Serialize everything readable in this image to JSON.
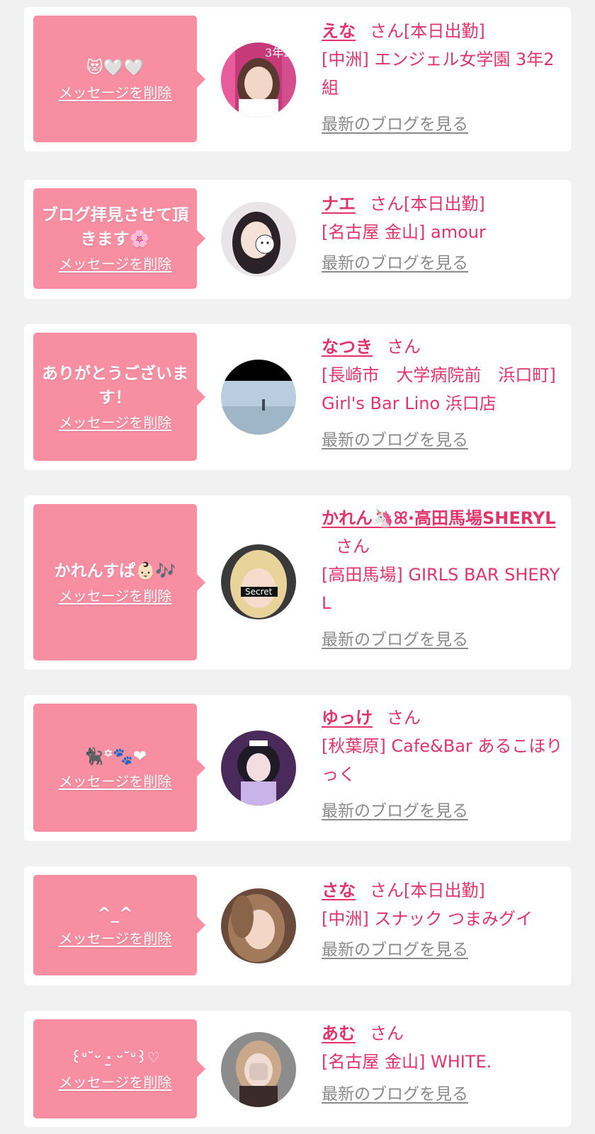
{
  "items": [
    {
      "message": "😻🤍🤍",
      "delete_label": "メッセージを削除",
      "name": "えな",
      "san": "さん",
      "status": "[本日出勤]",
      "shop": "[中洲] エンジェル女学園 3年2組",
      "blog_label": "最新のブログを見る"
    },
    {
      "message": "ブログ拝見させて頂きます🌸",
      "delete_label": "メッセージを削除",
      "name": "ナエ",
      "san": "さん",
      "status": "[本日出勤]",
      "shop": "[名古屋 金山] amour",
      "blog_label": "最新のブログを見る"
    },
    {
      "message": "ありがとうございます！",
      "delete_label": "メッセージを削除",
      "name": "なつき",
      "san": "さん",
      "status": "",
      "shop": "[長崎市　大学病院前　浜口町] Girl's Bar Lino 浜口店",
      "blog_label": "最新のブログを見る"
    },
    {
      "message": "かれんすぱ👶🏻🎶",
      "delete_label": "メッセージを削除",
      "name": "かれん🦄ꕤ·高田馬場SHERYL",
      "san": "さん",
      "status": "",
      "shop": "[高田馬場] GIRLS BAR SHERYL",
      "blog_label": "最新のブログを見る"
    },
    {
      "message": "🐈‍⬛꙳🐾❤",
      "delete_label": "メッセージを削除",
      "name": "ゆっけ",
      "san": "さん",
      "status": "",
      "shop": "[秋葉原] Cafe&Bar あるこほりっく",
      "blog_label": "最新のブログを見る"
    },
    {
      "message": "^_^",
      "delete_label": "メッセージを削除",
      "name": "さな",
      "san": "さん",
      "status": "[本日出勤]",
      "shop": "[中洲] スナック つまみグイ",
      "blog_label": "最新のブログを見る"
    },
    {
      "message": "꒰ᐡ˘ᵕ ·̫ ᵕ˘ᐡ꒱♡",
      "delete_label": "メッセージを削除",
      "name": "あむ",
      "san": "さん",
      "status": "",
      "shop": "[名古屋 金山] WHITE.",
      "blog_label": "最新のブログを見る"
    }
  ],
  "colors": {
    "page_bg": "#f1f1f1",
    "card_bg": "#ffffff",
    "bubble_bg": "#f88ea2",
    "accent_text": "#e0346a",
    "link_gray": "#8a8a8a"
  }
}
